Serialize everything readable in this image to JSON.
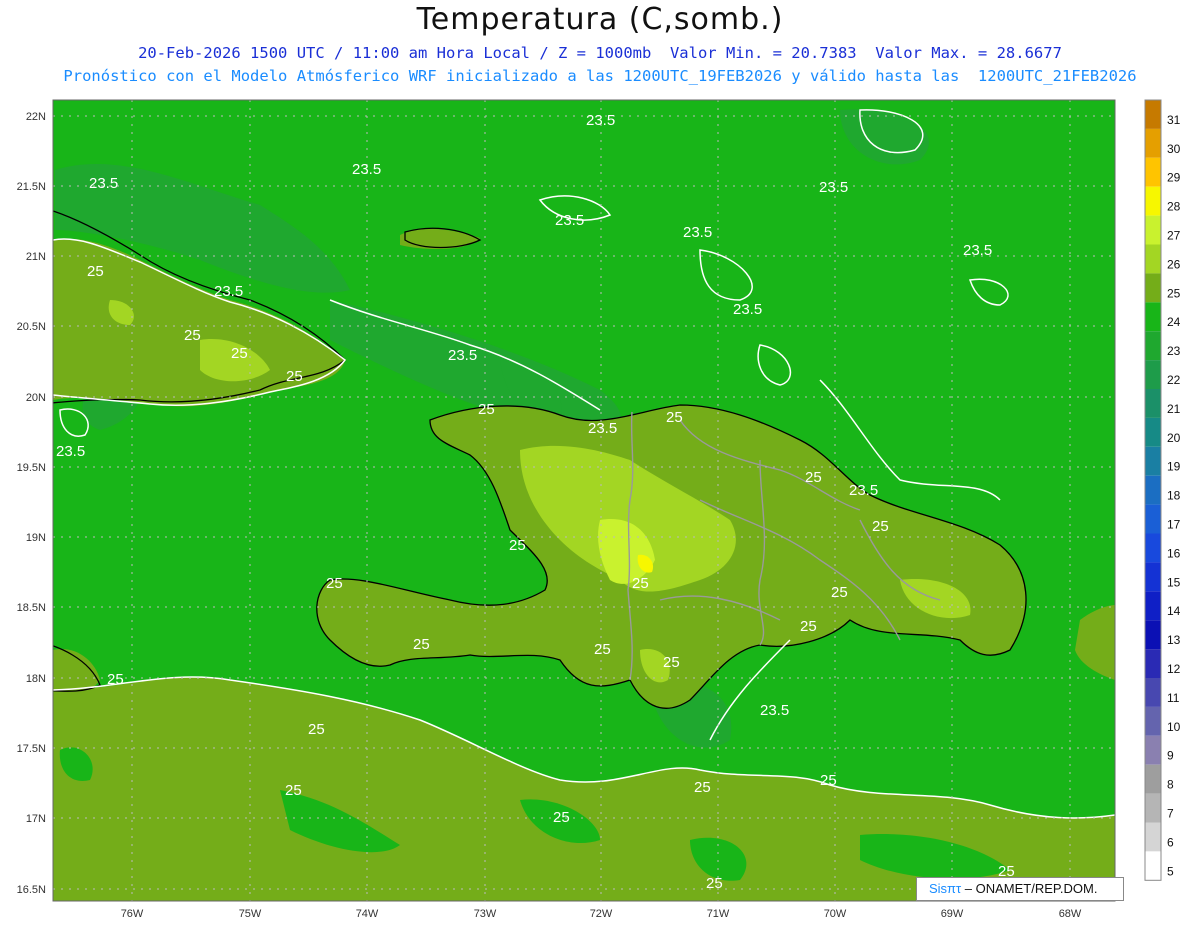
{
  "title": "Temperatura (C,somb.)",
  "subtitle1": "20-Feb-2026 1500 UTC / 11:00 am Hora Local / Z = 1000mb  Valor Min. = 20.7383  Valor Max. = 28.6677",
  "subtitle2": "Pronóstico con el Modelo Atmósferico WRF inicializado a las 1200UTC_19FEB2026 y válido hasta las  1200UTC_21FEB2026",
  "lat_labels": [
    "22N",
    "21.5N",
    "21N",
    "20.5N",
    "20N",
    "19.5N",
    "19N",
    "18.5N",
    "18N",
    "17.5N",
    "17N",
    "16.5N"
  ],
  "lon_labels": [
    "76W",
    "75W",
    "74W",
    "73W",
    "72W",
    "71W",
    "70W",
    "69W",
    "68W"
  ],
  "colorbar": {
    "labels": [
      "31",
      "30",
      "29",
      "28",
      "27",
      "26",
      "25",
      "24",
      "23",
      "22",
      "21",
      "20",
      "19",
      "18",
      "17",
      "16",
      "15",
      "14",
      "13",
      "12",
      "11",
      "10",
      "9",
      "8",
      "7",
      "6",
      "5"
    ],
    "colors": [
      "#c67a00",
      "#e59f00",
      "#ffc400",
      "#f7f700",
      "#c9f22e",
      "#a3d623",
      "#74ad19",
      "#18b518",
      "#1fa82f",
      "#1e9c4a",
      "#1b9068",
      "#168a86",
      "#1a7fa3",
      "#1b6ec2",
      "#1a5fd6",
      "#1849dd",
      "#1432d4",
      "#0f1fc6",
      "#0b10b4",
      "#2a2ab4",
      "#4848b0",
      "#6464ae",
      "#8a80b0",
      "#9e9e9e",
      "#b5b5b5",
      "#d5d5d5",
      "#ffffff"
    ]
  },
  "contour_labels": {
    "c235": "23.5",
    "c25": "25"
  },
  "credit": {
    "brand": "Sisπτ",
    "org": " –  ONAMET/REP.DOM."
  }
}
